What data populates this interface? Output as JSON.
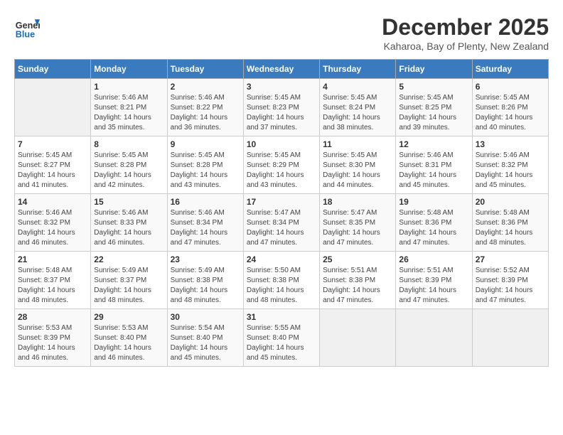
{
  "header": {
    "logo_line1": "General",
    "logo_line2": "Blue",
    "month": "December 2025",
    "location": "Kaharoa, Bay of Plenty, New Zealand"
  },
  "days_of_week": [
    "Sunday",
    "Monday",
    "Tuesday",
    "Wednesday",
    "Thursday",
    "Friday",
    "Saturday"
  ],
  "weeks": [
    [
      {
        "day": "",
        "info": ""
      },
      {
        "day": "1",
        "info": "Sunrise: 5:46 AM\nSunset: 8:21 PM\nDaylight: 14 hours\nand 35 minutes."
      },
      {
        "day": "2",
        "info": "Sunrise: 5:46 AM\nSunset: 8:22 PM\nDaylight: 14 hours\nand 36 minutes."
      },
      {
        "day": "3",
        "info": "Sunrise: 5:45 AM\nSunset: 8:23 PM\nDaylight: 14 hours\nand 37 minutes."
      },
      {
        "day": "4",
        "info": "Sunrise: 5:45 AM\nSunset: 8:24 PM\nDaylight: 14 hours\nand 38 minutes."
      },
      {
        "day": "5",
        "info": "Sunrise: 5:45 AM\nSunset: 8:25 PM\nDaylight: 14 hours\nand 39 minutes."
      },
      {
        "day": "6",
        "info": "Sunrise: 5:45 AM\nSunset: 8:26 PM\nDaylight: 14 hours\nand 40 minutes."
      }
    ],
    [
      {
        "day": "7",
        "info": "Sunrise: 5:45 AM\nSunset: 8:27 PM\nDaylight: 14 hours\nand 41 minutes."
      },
      {
        "day": "8",
        "info": "Sunrise: 5:45 AM\nSunset: 8:28 PM\nDaylight: 14 hours\nand 42 minutes."
      },
      {
        "day": "9",
        "info": "Sunrise: 5:45 AM\nSunset: 8:28 PM\nDaylight: 14 hours\nand 43 minutes."
      },
      {
        "day": "10",
        "info": "Sunrise: 5:45 AM\nSunset: 8:29 PM\nDaylight: 14 hours\nand 43 minutes."
      },
      {
        "day": "11",
        "info": "Sunrise: 5:45 AM\nSunset: 8:30 PM\nDaylight: 14 hours\nand 44 minutes."
      },
      {
        "day": "12",
        "info": "Sunrise: 5:46 AM\nSunset: 8:31 PM\nDaylight: 14 hours\nand 45 minutes."
      },
      {
        "day": "13",
        "info": "Sunrise: 5:46 AM\nSunset: 8:32 PM\nDaylight: 14 hours\nand 45 minutes."
      }
    ],
    [
      {
        "day": "14",
        "info": "Sunrise: 5:46 AM\nSunset: 8:32 PM\nDaylight: 14 hours\nand 46 minutes."
      },
      {
        "day": "15",
        "info": "Sunrise: 5:46 AM\nSunset: 8:33 PM\nDaylight: 14 hours\nand 46 minutes."
      },
      {
        "day": "16",
        "info": "Sunrise: 5:46 AM\nSunset: 8:34 PM\nDaylight: 14 hours\nand 47 minutes."
      },
      {
        "day": "17",
        "info": "Sunrise: 5:47 AM\nSunset: 8:34 PM\nDaylight: 14 hours\nand 47 minutes."
      },
      {
        "day": "18",
        "info": "Sunrise: 5:47 AM\nSunset: 8:35 PM\nDaylight: 14 hours\nand 47 minutes."
      },
      {
        "day": "19",
        "info": "Sunrise: 5:48 AM\nSunset: 8:36 PM\nDaylight: 14 hours\nand 47 minutes."
      },
      {
        "day": "20",
        "info": "Sunrise: 5:48 AM\nSunset: 8:36 PM\nDaylight: 14 hours\nand 48 minutes."
      }
    ],
    [
      {
        "day": "21",
        "info": "Sunrise: 5:48 AM\nSunset: 8:37 PM\nDaylight: 14 hours\nand 48 minutes."
      },
      {
        "day": "22",
        "info": "Sunrise: 5:49 AM\nSunset: 8:37 PM\nDaylight: 14 hours\nand 48 minutes."
      },
      {
        "day": "23",
        "info": "Sunrise: 5:49 AM\nSunset: 8:38 PM\nDaylight: 14 hours\nand 48 minutes."
      },
      {
        "day": "24",
        "info": "Sunrise: 5:50 AM\nSunset: 8:38 PM\nDaylight: 14 hours\nand 48 minutes."
      },
      {
        "day": "25",
        "info": "Sunrise: 5:51 AM\nSunset: 8:38 PM\nDaylight: 14 hours\nand 47 minutes."
      },
      {
        "day": "26",
        "info": "Sunrise: 5:51 AM\nSunset: 8:39 PM\nDaylight: 14 hours\nand 47 minutes."
      },
      {
        "day": "27",
        "info": "Sunrise: 5:52 AM\nSunset: 8:39 PM\nDaylight: 14 hours\nand 47 minutes."
      }
    ],
    [
      {
        "day": "28",
        "info": "Sunrise: 5:53 AM\nSunset: 8:39 PM\nDaylight: 14 hours\nand 46 minutes."
      },
      {
        "day": "29",
        "info": "Sunrise: 5:53 AM\nSunset: 8:40 PM\nDaylight: 14 hours\nand 46 minutes."
      },
      {
        "day": "30",
        "info": "Sunrise: 5:54 AM\nSunset: 8:40 PM\nDaylight: 14 hours\nand 45 minutes."
      },
      {
        "day": "31",
        "info": "Sunrise: 5:55 AM\nSunset: 8:40 PM\nDaylight: 14 hours\nand 45 minutes."
      },
      {
        "day": "",
        "info": ""
      },
      {
        "day": "",
        "info": ""
      },
      {
        "day": "",
        "info": ""
      }
    ]
  ]
}
